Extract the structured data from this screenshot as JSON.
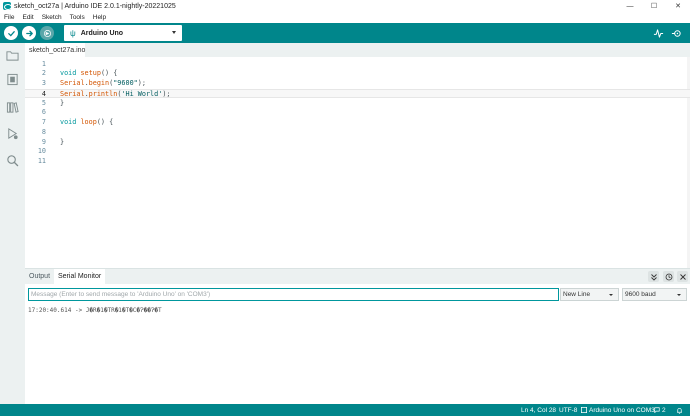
{
  "window": {
    "title": "sketch_oct27a | Arduino IDE 2.0.1-nightly-20221025",
    "controls": {
      "minimize": "—",
      "maximize": "☐",
      "close": "✕"
    }
  },
  "menu": {
    "items": [
      "File",
      "Edit",
      "Sketch",
      "Tools",
      "Help"
    ]
  },
  "toolbar": {
    "board": "Arduino Uno",
    "icons": [
      "verify-icon",
      "upload-icon",
      "debug-icon",
      "serial-plotter-icon",
      "serial-monitor-icon"
    ]
  },
  "sidebar": {
    "icons": [
      "sketchbook-folder-icon",
      "boards-manager-icon",
      "library-manager-icon",
      "debug-icon",
      "search-icon"
    ]
  },
  "editor": {
    "tab": "sketch_oct27a.ino",
    "active_line": 4,
    "lines": [
      {
        "num": "1",
        "tokens": []
      },
      {
        "num": "2",
        "tokens": [
          {
            "t": "void",
            "c": "kw"
          },
          {
            "t": " ",
            "c": ""
          },
          {
            "t": "setup",
            "c": "fn"
          },
          {
            "t": "() {",
            "c": ""
          }
        ]
      },
      {
        "num": "3",
        "tokens": [
          {
            "t": "Serial",
            "c": "fn"
          },
          {
            "t": ".",
            "c": ""
          },
          {
            "t": "begin",
            "c": "fn"
          },
          {
            "t": "(",
            "c": ""
          },
          {
            "t": "\"9600\"",
            "c": "str"
          },
          {
            "t": ");",
            "c": ""
          }
        ]
      },
      {
        "num": "4",
        "tokens": [
          {
            "t": "Serial",
            "c": "fn"
          },
          {
            "t": ".",
            "c": ""
          },
          {
            "t": "println",
            "c": "fn"
          },
          {
            "t": "(",
            "c": ""
          },
          {
            "t": "'Hi World'",
            "c": "str"
          },
          {
            "t": ");",
            "c": ""
          }
        ]
      },
      {
        "num": "5",
        "tokens": [
          {
            "t": "}",
            "c": ""
          }
        ]
      },
      {
        "num": "6",
        "tokens": []
      },
      {
        "num": "7",
        "tokens": [
          {
            "t": "void",
            "c": "kw"
          },
          {
            "t": " ",
            "c": ""
          },
          {
            "t": "loop",
            "c": "fn"
          },
          {
            "t": "() {",
            "c": ""
          }
        ]
      },
      {
        "num": "8",
        "tokens": []
      },
      {
        "num": "9",
        "tokens": [
          {
            "t": "}",
            "c": ""
          }
        ]
      },
      {
        "num": "10",
        "tokens": []
      },
      {
        "num": "11",
        "tokens": []
      }
    ]
  },
  "panel": {
    "tabs": [
      "Output",
      "Serial Monitor"
    ],
    "active_tab": "Serial Monitor",
    "message_placeholder": "Message (Enter to send message to 'Arduino Uno' on 'COM3')",
    "line_ending": "New Line",
    "baud_rate": "9600 baud",
    "output_line": "17:20:40.614 -> J�R�1�TR�1�T�C�Ɂ��Ɂ�T"
  },
  "status": {
    "cursor": "Ln 4, Col 28",
    "encoding": "UTF-8",
    "board_port": "Arduino Uno on COM3",
    "notifications": "2"
  },
  "colors": {
    "accent": "#00868b",
    "keyword": "#00979d",
    "function": "#d35400",
    "string": "#005c5f"
  }
}
